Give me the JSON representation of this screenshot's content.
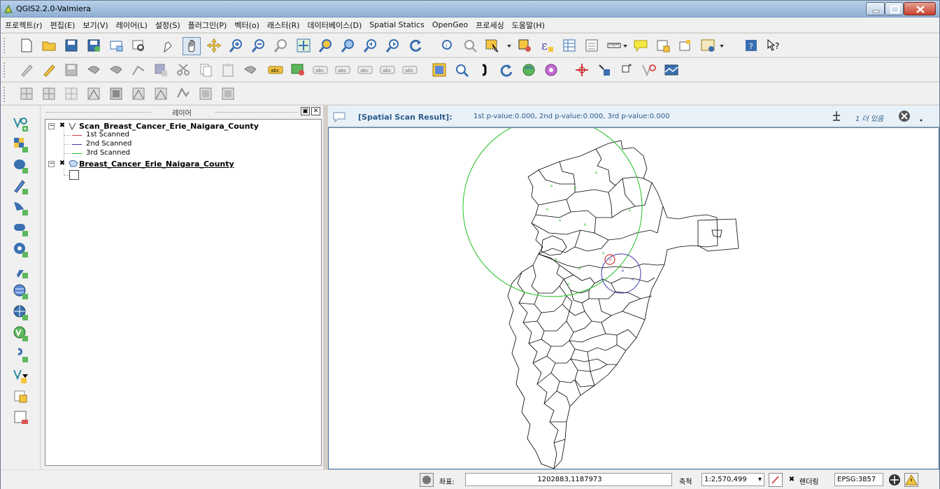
{
  "window": {
    "title": "QGIS2.2.0-Valmiera"
  },
  "menu": [
    "프로젝트(r)",
    "편집(E)",
    "보기(V)",
    "레이어(L)",
    "설정(S)",
    "플러그인(P)",
    "벡터(o)",
    "래스터(R)",
    "데이터베이스(D)",
    "Spatial Statics",
    "OpenGeo",
    "프로세싱",
    "도움말(H)"
  ],
  "layers_panel": {
    "title": "레이어",
    "layers": [
      {
        "name": "Scan_Breast_Cancer_Erie_Naigara_County",
        "checked": true,
        "icon": "line-layer-icon",
        "legend": [
          {
            "label": "1st Scanned",
            "color": "#d44040"
          },
          {
            "label": "2nd Scanned",
            "color": "#3a3aaa"
          },
          {
            "label": "3rd Scanned",
            "color": "#22c022"
          }
        ]
      },
      {
        "name": "Breast_Cancer_Erie_Naigara_County",
        "checked": true,
        "icon": "polygon-layer-icon"
      }
    ]
  },
  "message_bar": {
    "title": "[Spatial Scan Result]:",
    "body": "1st p-value:0.000, 2nd p-value:0.000, 3rd p-value:0.000",
    "more": "1 더 있음"
  },
  "status": {
    "coord_label": "좌표:",
    "coord_value": "1202883,1187973",
    "scale_label": "축척",
    "scale_value": "1:2,570,499",
    "render_label": "렌더링",
    "crs": "EPSG:3857"
  },
  "colors": {
    "scan1": "#d44040",
    "scan2": "#3a3aaa",
    "scan3": "#22c022",
    "accent": "#2a5b8c"
  }
}
